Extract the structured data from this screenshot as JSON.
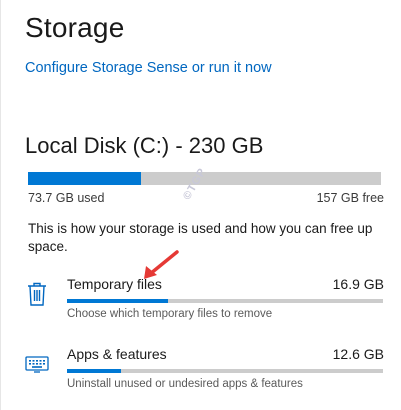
{
  "page": {
    "title": "Storage",
    "configure_link": "Configure Storage Sense or run it now"
  },
  "disk": {
    "title": "Local Disk (C:) - 230 GB",
    "used": "73.7 GB used",
    "free": "157 GB free",
    "used_fraction": 0.32,
    "description": "This is how your storage is used and how you can free up space."
  },
  "categories": [
    {
      "name": "Temporary files",
      "size": "16.9 GB",
      "subtitle": "Choose which temporary files to remove",
      "fraction": 0.32,
      "icon": "trash-icon"
    },
    {
      "name": "Apps & features",
      "size": "12.6 GB",
      "subtitle": "Uninstall unused or undesired apps & features",
      "fraction": 0.17,
      "icon": "keyboard-icon"
    }
  ],
  "watermark": "©TGP",
  "colors": {
    "accent": "#0078d4",
    "link": "#0067c0",
    "bar_bg": "#cccccc",
    "arrow": "#e53935"
  }
}
